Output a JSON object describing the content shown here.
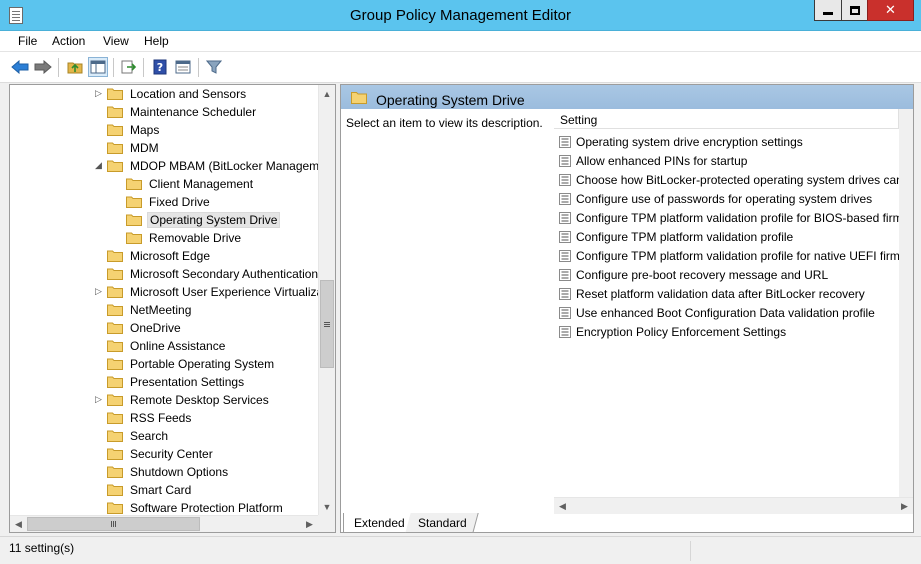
{
  "window": {
    "title": "Group Policy Management Editor"
  },
  "menu": {
    "file": "File",
    "action": "Action",
    "view": "View",
    "help": "Help"
  },
  "toolbar": [
    "back-arrow-icon",
    "forward-arrow-icon",
    "up-folder-icon",
    "show-hide-tree-icon",
    "export-list-icon",
    "help-icon",
    "properties-icon",
    "filter-icon"
  ],
  "tree": {
    "items": [
      {
        "label": "Location and Sensors",
        "expandable": true,
        "indent": 0
      },
      {
        "label": "Maintenance Scheduler",
        "expandable": false,
        "indent": 0
      },
      {
        "label": "Maps",
        "expandable": false,
        "indent": 0
      },
      {
        "label": "MDM",
        "expandable": false,
        "indent": 0
      },
      {
        "label": "MDOP MBAM (BitLocker Management",
        "expandable": true,
        "expanded": true,
        "indent": 0
      },
      {
        "label": "Client Management",
        "expandable": false,
        "indent": 1
      },
      {
        "label": "Fixed Drive",
        "expandable": false,
        "indent": 1
      },
      {
        "label": "Operating System Drive",
        "expandable": false,
        "indent": 1,
        "selected": true
      },
      {
        "label": "Removable Drive",
        "expandable": false,
        "indent": 1
      },
      {
        "label": "Microsoft Edge",
        "expandable": false,
        "indent": 0
      },
      {
        "label": "Microsoft Secondary Authentication",
        "expandable": false,
        "indent": 0
      },
      {
        "label": "Microsoft User Experience Virtualizat",
        "expandable": true,
        "indent": 0
      },
      {
        "label": "NetMeeting",
        "expandable": false,
        "indent": 0
      },
      {
        "label": "OneDrive",
        "expandable": false,
        "indent": 0
      },
      {
        "label": "Online Assistance",
        "expandable": false,
        "indent": 0
      },
      {
        "label": "Portable Operating System",
        "expandable": false,
        "indent": 0
      },
      {
        "label": "Presentation Settings",
        "expandable": false,
        "indent": 0
      },
      {
        "label": "Remote Desktop Services",
        "expandable": true,
        "indent": 0
      },
      {
        "label": "RSS Feeds",
        "expandable": false,
        "indent": 0
      },
      {
        "label": "Search",
        "expandable": false,
        "indent": 0
      },
      {
        "label": "Security Center",
        "expandable": false,
        "indent": 0
      },
      {
        "label": "Shutdown Options",
        "expandable": false,
        "indent": 0
      },
      {
        "label": "Smart Card",
        "expandable": false,
        "indent": 0
      },
      {
        "label": "Software Protection Platform",
        "expandable": false,
        "indent": 0
      }
    ]
  },
  "detail": {
    "heading": "Operating System Drive",
    "description": "Select an item to view its description.",
    "column_header": "Setting",
    "settings": [
      "Operating system drive encryption settings",
      "Allow enhanced PINs for startup",
      "Choose how BitLocker-protected operating system drives can be recovered",
      "Configure use of passwords for operating system drives",
      "Configure TPM platform validation profile for BIOS-based firmware configurations",
      "Configure TPM platform validation profile",
      "Configure TPM platform validation profile for native UEFI firmware configurations",
      "Configure pre-boot recovery message and URL",
      "Reset platform validation data after BitLocker recovery",
      "Use enhanced Boot Configuration Data validation profile",
      "Encryption Policy Enforcement Settings"
    ]
  },
  "tabs": {
    "extended": "Extended",
    "standard": "Standard"
  },
  "status": {
    "text": "11 setting(s)"
  },
  "colors": {
    "titlebar": "#5bc4ee",
    "header": "#a9c7e4",
    "close": "#c9302c",
    "folder": "#f2c75a"
  }
}
